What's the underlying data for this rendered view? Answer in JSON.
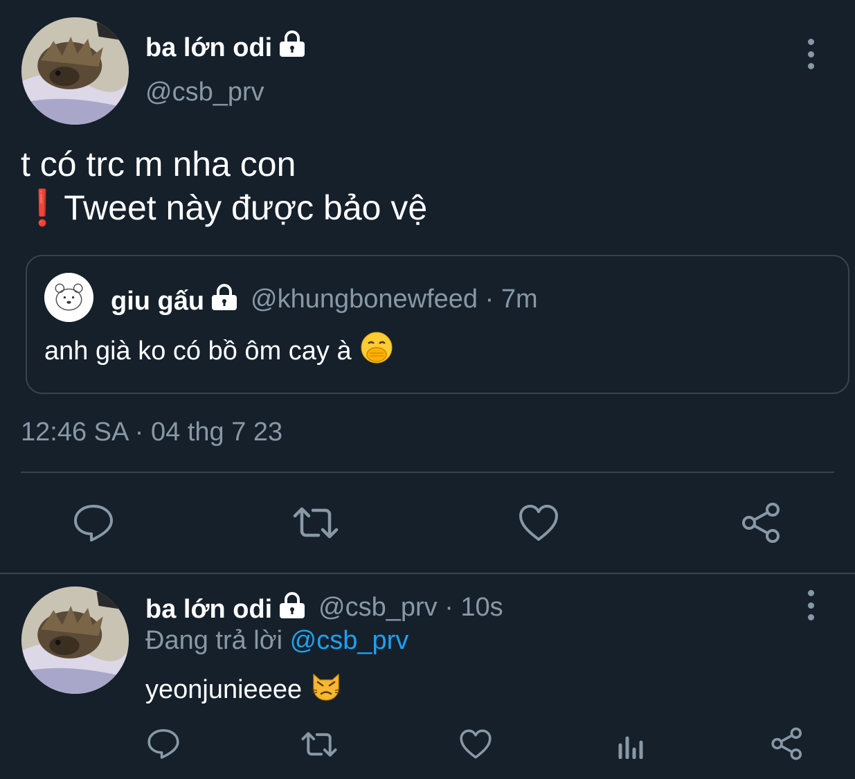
{
  "main_tweet": {
    "display_name": "ba lớn odi",
    "handle": "@csb_prv",
    "text_line1": "t có trc m nha con",
    "text_line2": "❗Tweet này được bảo vệ",
    "quoted": {
      "display_name": "giu gấu",
      "handle_time": "@khungbonewfeed · 7m",
      "text": "anh già ko có bồ ôm cay à"
    },
    "timestamp": "12:46 SA · 04 thg 7 23",
    "actions": [
      "reply-icon",
      "retweet-icon",
      "like-icon",
      "share-icon"
    ]
  },
  "reply_tweet": {
    "display_name": "ba lớn odi",
    "handle_time": "@csb_prv · 10s",
    "replying_prefix": "Đang trả lời ",
    "replying_to": "@csb_prv",
    "text": "yeonjunieeee",
    "actions": [
      "reply-icon",
      "retweet-icon",
      "like-icon",
      "analytics-icon",
      "share-icon"
    ]
  },
  "colors": {
    "background": "#15202b",
    "secondary_text": "#8899a6",
    "border": "#38444d",
    "accent": "#1da1f2"
  }
}
